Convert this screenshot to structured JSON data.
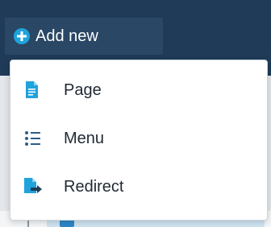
{
  "toolbar": {
    "add_new_label": "Add new",
    "add_new_icon": "plus-circle-icon"
  },
  "dropdown": {
    "items": [
      {
        "label": "Page",
        "icon": "page-icon"
      },
      {
        "label": "Menu",
        "icon": "menu-list-icon"
      },
      {
        "label": "Redirect",
        "icon": "redirect-icon"
      }
    ]
  },
  "colors": {
    "topbar": "#1f3b58",
    "button": "#2a4765",
    "accent": "#1fa3dc",
    "menu_icon": "#2f5d86",
    "text": "#1f2933"
  }
}
